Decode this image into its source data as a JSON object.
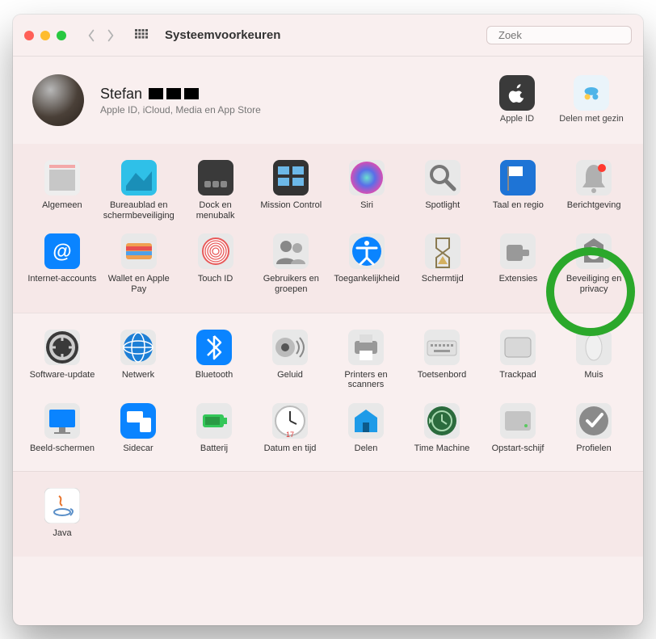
{
  "window": {
    "title": "Systeemvoorkeuren",
    "search_placeholder": "Zoek"
  },
  "profile": {
    "name": "Stefan",
    "subtitle": "Apple ID, iCloud, Media en App Store",
    "items": [
      {
        "id": "apple-id",
        "label": "Apple ID"
      },
      {
        "id": "family-sharing",
        "label": "Delen met gezin"
      }
    ]
  },
  "sections": [
    {
      "kind": "alt",
      "items": [
        {
          "id": "general",
          "label": "Algemeen",
          "bg": "#eeeeee"
        },
        {
          "id": "desktop",
          "label": "Bureaublad en schermbeveiliging",
          "bg": "#2fc0e8"
        },
        {
          "id": "dock",
          "label": "Dock en menubalk",
          "bg": "#3a3a3a"
        },
        {
          "id": "mission-control",
          "label": "Mission Control",
          "bg": "#333333"
        },
        {
          "id": "siri",
          "label": "Siri",
          "bg": "radial"
        },
        {
          "id": "spotlight",
          "label": "Spotlight",
          "bg": "#ffffff"
        },
        {
          "id": "language-region",
          "label": "Taal en regio",
          "bg": "#1e74d6"
        },
        {
          "id": "notifications",
          "label": "Berichtgeving",
          "bg": "#cfcfcf",
          "badge": true
        },
        {
          "id": "internet-accounts",
          "label": "Internet-accounts",
          "bg": "#0a84ff"
        },
        {
          "id": "wallet",
          "label": "Wallet en Apple Pay",
          "bg": "#e8e8e8"
        },
        {
          "id": "touch-id",
          "label": "Touch ID",
          "bg": "#ffffff"
        },
        {
          "id": "users-groups",
          "label": "Gebruikers en groepen",
          "bg": "#bfbfbf"
        },
        {
          "id": "accessibility",
          "label": "Toegankelijkheid",
          "bg": "#ffffff"
        },
        {
          "id": "screen-time",
          "label": "Schermtijd",
          "bg": "#ffffff"
        },
        {
          "id": "extensions",
          "label": "Extensies",
          "bg": "#d5d5d5"
        },
        {
          "id": "security",
          "label": "Beveiliging en privacy",
          "bg": "#c8c8c8",
          "highlighted": true
        }
      ]
    },
    {
      "kind": "plain",
      "items": [
        {
          "id": "software-update",
          "label": "Software-update",
          "bg": "#3a3a3a"
        },
        {
          "id": "network",
          "label": "Netwerk",
          "bg": "#1c7fd6"
        },
        {
          "id": "bluetooth",
          "label": "Bluetooth",
          "bg": "#0a84ff"
        },
        {
          "id": "sound",
          "label": "Geluid",
          "bg": "#eaeaea"
        },
        {
          "id": "printers",
          "label": "Printers en scanners",
          "bg": "#d8d8d8"
        },
        {
          "id": "keyboard",
          "label": "Toetsenbord",
          "bg": "#e0e0e0"
        },
        {
          "id": "trackpad",
          "label": "Trackpad",
          "bg": "#d8d8d8"
        },
        {
          "id": "mouse",
          "label": "Muis",
          "bg": "#f0f0f0"
        },
        {
          "id": "displays",
          "label": "Beeld-schermen",
          "bg": "#0a84ff"
        },
        {
          "id": "sidecar",
          "label": "Sidecar",
          "bg": "#0a84ff"
        },
        {
          "id": "battery",
          "label": "Batterij",
          "bg": "#34c759"
        },
        {
          "id": "date-time",
          "label": "Datum en tijd",
          "bg": "#ffffff"
        },
        {
          "id": "sharing",
          "label": "Delen",
          "bg": "#1e9be8"
        },
        {
          "id": "time-machine",
          "label": "Time Machine",
          "bg": "#2b6b3d"
        },
        {
          "id": "startup-disk",
          "label": "Opstart-schijf",
          "bg": "#c4c4c4"
        },
        {
          "id": "profiles",
          "label": "Profielen",
          "bg": "#8a8a8a"
        }
      ]
    },
    {
      "kind": "alt",
      "items": [
        {
          "id": "java",
          "label": "Java",
          "bg": "#ffffff"
        }
      ]
    }
  ],
  "date_time_day": "17"
}
